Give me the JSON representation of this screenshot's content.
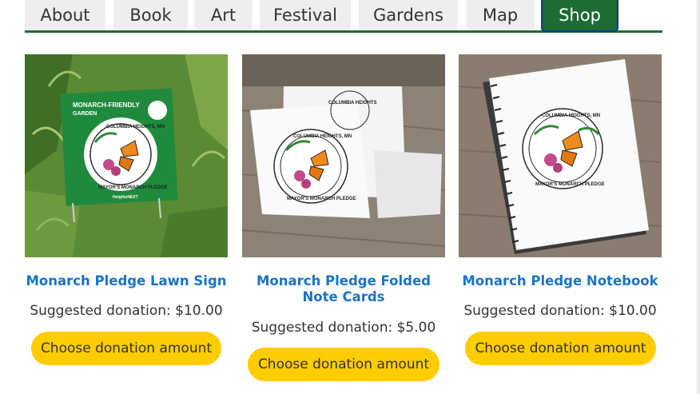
{
  "nav": {
    "tabs": [
      {
        "label": "About"
      },
      {
        "label": "Book"
      },
      {
        "label": "Art"
      },
      {
        "label": "Festival"
      },
      {
        "label": "Gardens"
      },
      {
        "label": "Map"
      },
      {
        "label": "Shop",
        "active": true
      }
    ]
  },
  "colors": {
    "brand_green": "#1e6b35",
    "link_blue": "#1a73c9",
    "button_yellow": "#ffcc00",
    "tab_gray": "#eeeeee"
  },
  "products": [
    {
      "title": "Monarch Pledge Lawn Sign",
      "price": "Suggested donation: $10.00",
      "button": "Choose donation amount",
      "image_text": {
        "heading": "MONARCH-FRIENDLY GARDEN",
        "seal_top": "COLUMBIA HEIGHTS, MN",
        "seal_bottom": "MAYOR'S MONARCH PLEDGE",
        "sponsor": "HeightsNEXT"
      }
    },
    {
      "title": "Monarch Pledge Folded Note Cards",
      "price": "Suggested donation: $5.00",
      "button": "Choose donation amount",
      "image_text": {
        "seal_top": "COLUMBIA HEIGHTS, MN",
        "seal_bottom": "MAYOR'S MONARCH PLEDGE"
      }
    },
    {
      "title": "Monarch Pledge Notebook",
      "price": "Suggested donation: $10.00",
      "button": "Choose donation amount",
      "image_text": {
        "seal_top": "COLUMBIA HEIGHTS, MN",
        "seal_bottom": "MAYOR'S MONARCH PLEDGE"
      }
    }
  ]
}
